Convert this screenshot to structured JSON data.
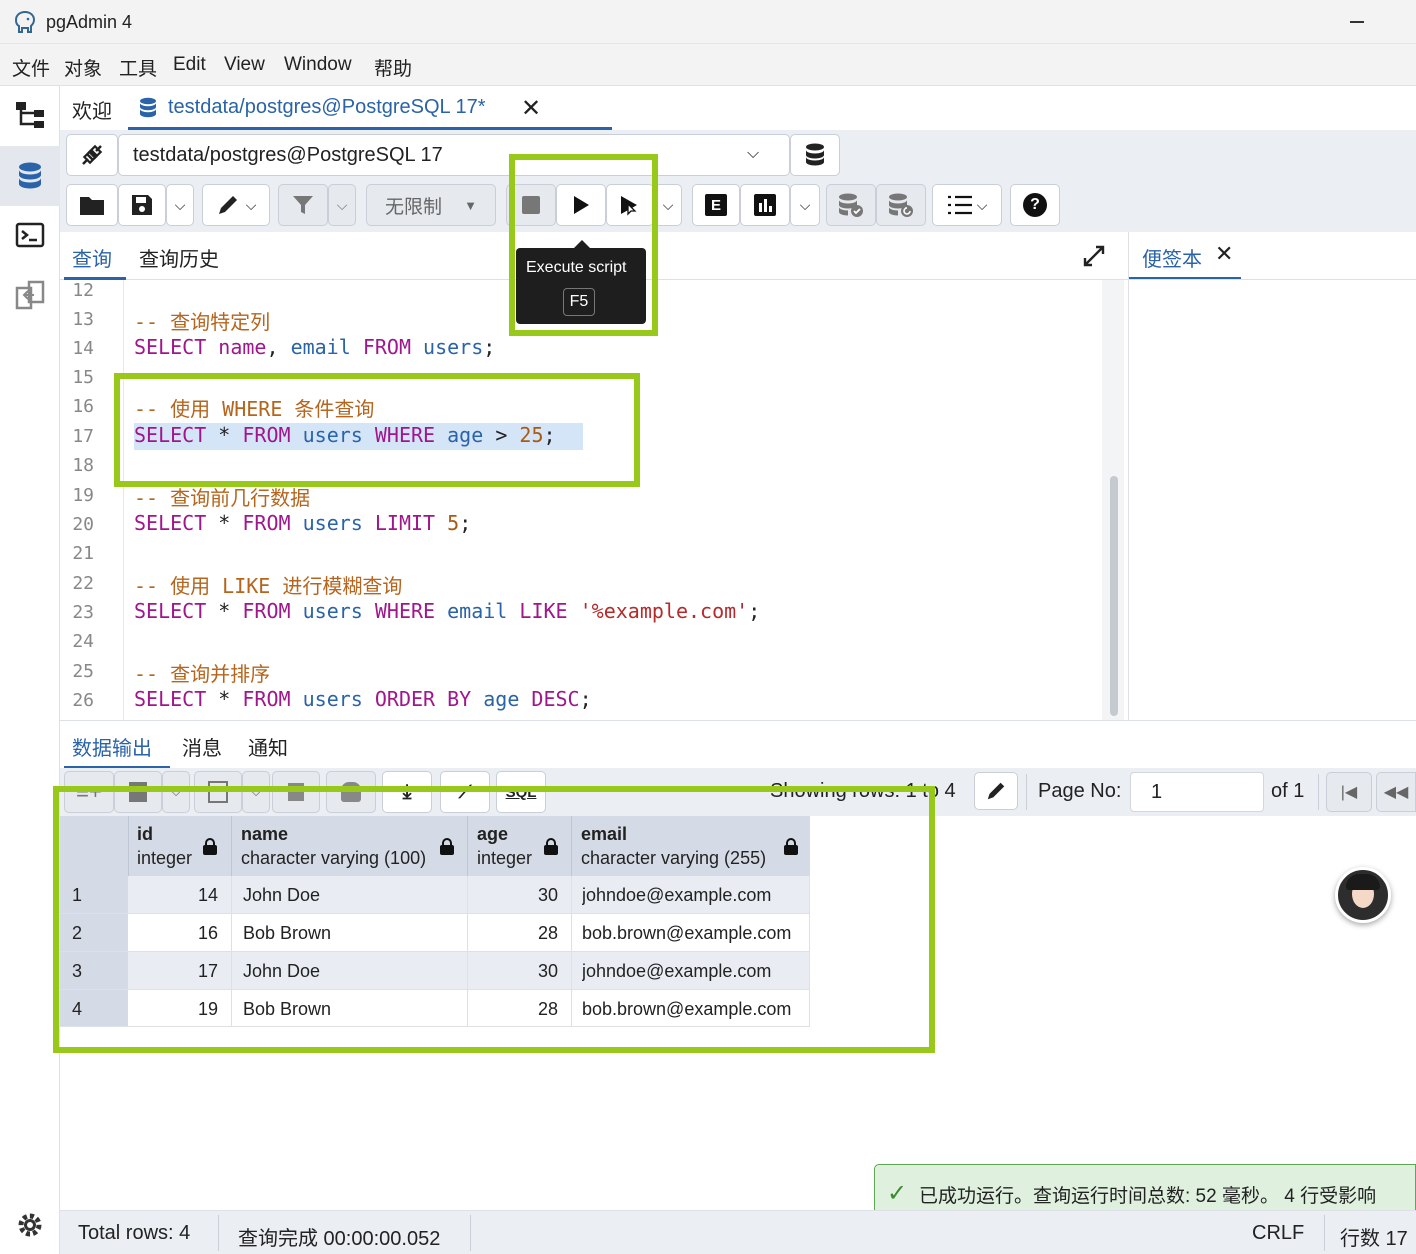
{
  "window": {
    "title": "pgAdmin 4"
  },
  "menu": [
    "文件",
    "对象",
    "工具",
    "Edit",
    "View",
    "Window",
    "帮助"
  ],
  "tabs": [
    {
      "label": "欢迎"
    },
    {
      "label": "testdata/postgres@PostgreSQL 17*"
    }
  ],
  "connection": {
    "label": "testdata/postgres@PostgreSQL 17"
  },
  "toolbar": {
    "limit_label": "无限制"
  },
  "tooltip": {
    "title": "Execute script",
    "shortcut": "F5"
  },
  "editor_tabs": [
    "查询",
    "查询历史"
  ],
  "notepad": {
    "label": "便签本"
  },
  "code": {
    "line_numbers": [
      "12",
      "13",
      "14",
      "15",
      "16",
      "17",
      "18",
      "19",
      "20",
      "21",
      "22",
      "23",
      "24",
      "25",
      "26"
    ],
    "c13": "-- 查询特定列",
    "c16": "-- 使用 WHERE 条件查询",
    "c19": "-- 查询前几行数据",
    "c22": "-- 使用 LIKE 进行模糊查询",
    "c25": "-- 查询并排序",
    "kw_select": "SELECT",
    "kw_from": "FROM",
    "kw_where": "WHERE",
    "kw_limit": "LIMIT",
    "kw_like": "LIKE",
    "kw_order": "ORDER BY",
    "kw_desc": "DESC",
    "id_name": "name",
    "id_email": "email",
    "id_users": "users",
    "id_age": "age",
    "star": "*",
    "comma": ",",
    "semi": ";",
    "gt": ">",
    "n25": "25",
    "n5": "5",
    "s_example": "'%example.com'"
  },
  "results_tabs": [
    "数据输出",
    "消息",
    "通知"
  ],
  "pagination": {
    "showing": "Showing rows: 1 to 4",
    "page_no_label": "Page No:",
    "page_value": "1",
    "of": "of 1"
  },
  "grid": {
    "columns": [
      {
        "name": "id",
        "type": "integer"
      },
      {
        "name": "name",
        "type": "character varying (100)"
      },
      {
        "name": "age",
        "type": "integer"
      },
      {
        "name": "email",
        "type": "character varying (255)"
      }
    ],
    "rows": [
      {
        "n": "1",
        "id": "14",
        "name": "John Doe",
        "age": "30",
        "email": "johndoe@example.com"
      },
      {
        "n": "2",
        "id": "16",
        "name": "Bob Brown",
        "age": "28",
        "email": "bob.brown@example.com"
      },
      {
        "n": "3",
        "id": "17",
        "name": "John Doe",
        "age": "30",
        "email": "johndoe@example.com"
      },
      {
        "n": "4",
        "id": "19",
        "name": "Bob Brown",
        "age": "28",
        "email": "bob.brown@example.com"
      }
    ]
  },
  "toast": {
    "text": "已成功运行。查询运行时间总数: 52 毫秒。 4 行受影响"
  },
  "status": {
    "total_rows": "Total rows: 4",
    "query_done": "查询完成 00:00:00.052",
    "line_ending": "CRLF",
    "line_info": "行数 17"
  },
  "colors": {
    "accent": "#2a63a8",
    "highlight": "#97c81a",
    "keyword": "#a0168c",
    "comment": "#b5651d"
  }
}
